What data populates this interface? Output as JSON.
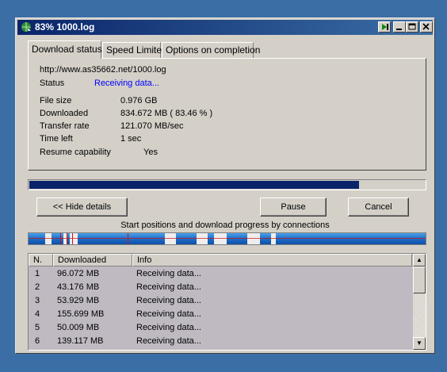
{
  "window": {
    "title": "83% 1000.log"
  },
  "tabs": [
    {
      "label": "Download status"
    },
    {
      "label": "Speed Limiter"
    },
    {
      "label": "Options on completion"
    }
  ],
  "status": {
    "url": "http://www.as35662.net/1000.log",
    "status_label": "Status",
    "status_value": "Receiving data...",
    "file_size_label": "File size",
    "file_size_value": "0.976  GB",
    "downloaded_label": "Downloaded",
    "downloaded_value": "834.672  MB  ( 83.46 % )",
    "transfer_rate_label": "Transfer rate",
    "transfer_rate_value": "121.070  MB/sec",
    "time_left_label": "Time left",
    "time_left_value": "1 sec",
    "resume_label": "Resume capability",
    "resume_value": "Yes"
  },
  "progress": {
    "fraction": 0.8346
  },
  "buttons": {
    "hide_details": "<< Hide details",
    "pause": "Pause",
    "cancel": "Cancel"
  },
  "connections_caption": "Start positions and download progress by connections",
  "list": {
    "columns": [
      "N.",
      "Downloaded",
      "Info"
    ],
    "rows": [
      {
        "n": "1",
        "downloaded": "96.072  MB",
        "info": "Receiving data..."
      },
      {
        "n": "2",
        "downloaded": "43.176  MB",
        "info": "Receiving data..."
      },
      {
        "n": "3",
        "downloaded": "53.929  MB",
        "info": "Receiving data..."
      },
      {
        "n": "4",
        "downloaded": "155.699  MB",
        "info": "Receiving data..."
      },
      {
        "n": "5",
        "downloaded": "50.009  MB",
        "info": "Receiving data..."
      },
      {
        "n": "6",
        "downloaded": "139.117  MB",
        "info": "Receiving data..."
      }
    ]
  },
  "colors": {
    "titlebar": "#0a246a",
    "status_text": "#0000ff",
    "progress": "#0a246a"
  }
}
